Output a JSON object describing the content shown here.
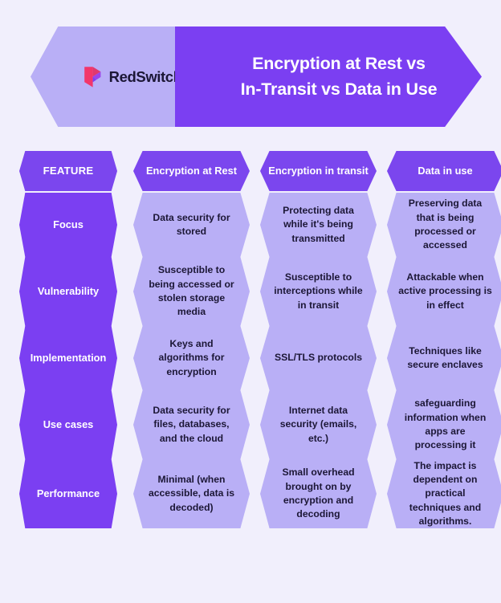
{
  "background_color": "#f1effc",
  "colors": {
    "accent_purple": "#7b3ff2",
    "header_purple": "#7b46ee",
    "light_lavender": "#b9aff6",
    "text_dark": "#1c1736",
    "logo_pink": "#f2366a",
    "logo_purple": "#7b3ff2"
  },
  "banner": {
    "logo_name": "RedSwitches",
    "logo_icon": "redswitches-bookmark-arrow-icon",
    "title_line_1": "Encryption at Rest vs",
    "title_line_2": "In-Transit vs Data in Use"
  },
  "table": {
    "headers": [
      "FEATURE",
      "Encryption at Rest",
      "Encryption in transit",
      "Data in use"
    ],
    "rows": [
      {
        "feature": "Focus",
        "values": [
          "Data security for stored",
          "Protecting data while it's being transmitted",
          "Preserving data that is being processed or accessed"
        ]
      },
      {
        "feature": "Vulnerability",
        "values": [
          "Susceptible to being accessed or stolen storage media",
          "Susceptible to interceptions while in transit",
          "Attackable when active processing is in effect"
        ]
      },
      {
        "feature": "Implementation",
        "values": [
          "Keys and algorithms for encryption",
          "SSL/TLS protocols",
          "Techniques like secure enclaves"
        ]
      },
      {
        "feature": "Use cases",
        "values": [
          "Data security for files, databases, and the cloud",
          "Internet data security (emails, etc.)",
          "safeguarding information when apps are processing it"
        ]
      },
      {
        "feature": "Performance",
        "values": [
          "Minimal (when accessible, data is decoded)",
          "Small overhead brought on by encryption and decoding",
          "The impact is dependent on practical techniques and algorithms."
        ]
      }
    ]
  }
}
